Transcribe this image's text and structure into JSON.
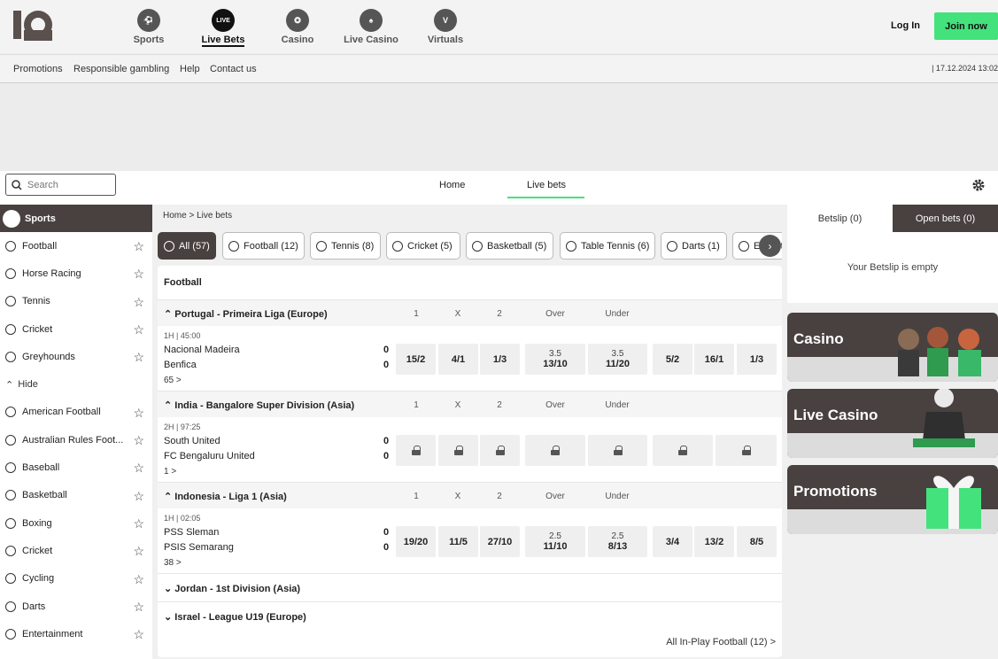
{
  "header": {
    "nav": [
      {
        "label": "Sports",
        "icon": "football-icon"
      },
      {
        "label": "Live Bets",
        "icon": "live-icon",
        "badge": "LIVE"
      },
      {
        "label": "Casino",
        "icon": "chip-icon"
      },
      {
        "label": "Live Casino",
        "icon": "dealer-icon"
      },
      {
        "label": "Virtuals",
        "icon": "virtuals-icon",
        "badge": "V"
      }
    ],
    "login": "Log In",
    "join": "Join now"
  },
  "subnav": {
    "links": [
      "Promotions",
      "Responsible gambling",
      "Help",
      "Contact us"
    ],
    "datetime": "| 17.12.2024 13:02"
  },
  "searchbar": {
    "placeholder": "Search",
    "tabs": [
      "Home",
      "Live bets"
    ]
  },
  "sidebar": {
    "title": "Sports",
    "top": [
      "Football",
      "Horse Racing",
      "Tennis",
      "Cricket",
      "Greyhounds"
    ],
    "hide": "Hide",
    "rest": [
      "American Football",
      "Australian Rules Foot...",
      "Baseball",
      "Basketball",
      "Boxing",
      "Cricket",
      "Cycling",
      "Darts",
      "Entertainment"
    ]
  },
  "main": {
    "breadcrumb": "Home > Live bets",
    "pills": [
      "All (57)",
      "Football (12)",
      "Tennis (8)",
      "Cricket (5)",
      "Basketball (5)",
      "Table Tennis (6)",
      "Darts (1)",
      "ESport"
    ],
    "section": "Football",
    "columns": [
      "1",
      "X",
      "2",
      "Over",
      "Under"
    ],
    "leagues": [
      {
        "name": "Portugal - Primeira Liga (Europe)",
        "period": "1H",
        "clock": "45:00",
        "home": "Nacional Madeira",
        "away": "Benfica",
        "home_score": "0",
        "away_score": "0",
        "more": "65 >",
        "odds": [
          "15/2",
          "4/1",
          "1/3"
        ],
        "over": {
          "line": "3.5",
          "odds": "13/10"
        },
        "under": {
          "line": "3.5",
          "odds": "11/20"
        },
        "extra": [
          "5/2",
          "16/1",
          "1/3"
        ]
      },
      {
        "name": "India - Bangalore Super Division (Asia)",
        "period": "2H",
        "clock": "97:25",
        "home": "South United",
        "away": "FC Bengaluru United",
        "home_score": "0",
        "away_score": "0",
        "more": "1 >",
        "locked": true
      },
      {
        "name": "Indonesia - Liga 1 (Asia)",
        "period": "1H",
        "clock": "02:05",
        "home": "PSS Sleman",
        "away": "PSIS Semarang",
        "home_score": "0",
        "away_score": "0",
        "more": "38 >",
        "odds": [
          "19/20",
          "11/5",
          "27/10"
        ],
        "over": {
          "line": "2.5",
          "odds": "11/10"
        },
        "under": {
          "line": "2.5",
          "odds": "8/13"
        },
        "extra": [
          "3/4",
          "13/2",
          "8/5"
        ]
      }
    ],
    "collapsed": [
      "Jordan - 1st Division (Asia)",
      "Israel - League U19 (Europe)"
    ],
    "all_inplay": "All In-Play Football (12) >"
  },
  "betslip": {
    "tab_betslip": "Betslip (0)",
    "tab_open": "Open bets (0)",
    "empty": "Your Betslip is empty"
  },
  "promos": [
    "Casino",
    "Live Casino",
    "Promotions"
  ],
  "colors": {
    "accent": "#44e27d",
    "dark": "#48413f"
  }
}
